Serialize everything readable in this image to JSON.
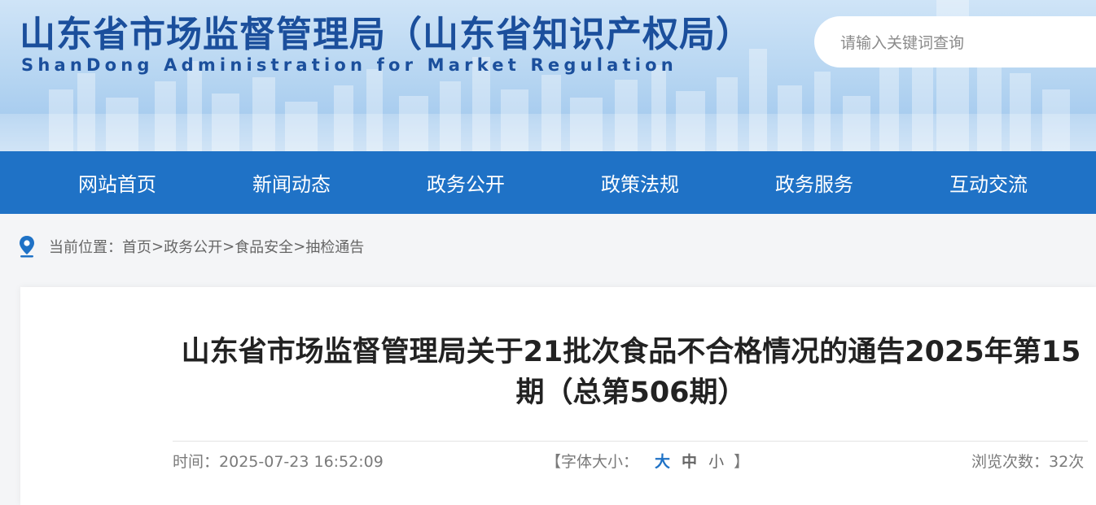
{
  "header": {
    "title": "山东省市场监督管理局（山东省知识产权局）",
    "subtitle": "ShanDong Administration for Market Regulation",
    "search_placeholder": "请输入关键词查询"
  },
  "nav": {
    "items": [
      "网站首页",
      "新闻动态",
      "政务公开",
      "政策法规",
      "政务服务",
      "互动交流"
    ]
  },
  "breadcrumb": {
    "prefix": "当前位置：",
    "items": [
      "首页",
      "政务公开",
      "食品安全",
      "抽检通告"
    ],
    "separator": ">"
  },
  "article": {
    "title": "山东省市场监督管理局关于21批次食品不合格情况的通告2025年第15期（总第506期）",
    "time_label": "时间：",
    "time_value": "2025-07-23 16:52:09",
    "font_size_label": "字体大小：",
    "bracket_open": "【",
    "bracket_close": "】",
    "font_sizes": [
      "大",
      "中",
      "小"
    ],
    "views_label": "浏览次数：",
    "views_value": "32次"
  },
  "colors": {
    "nav_bg": "#1f72c6",
    "title_blue": "#1b4f9c",
    "active_font_size": "#1f72c6"
  },
  "icons": {
    "breadcrumb": "location-pin-icon"
  }
}
